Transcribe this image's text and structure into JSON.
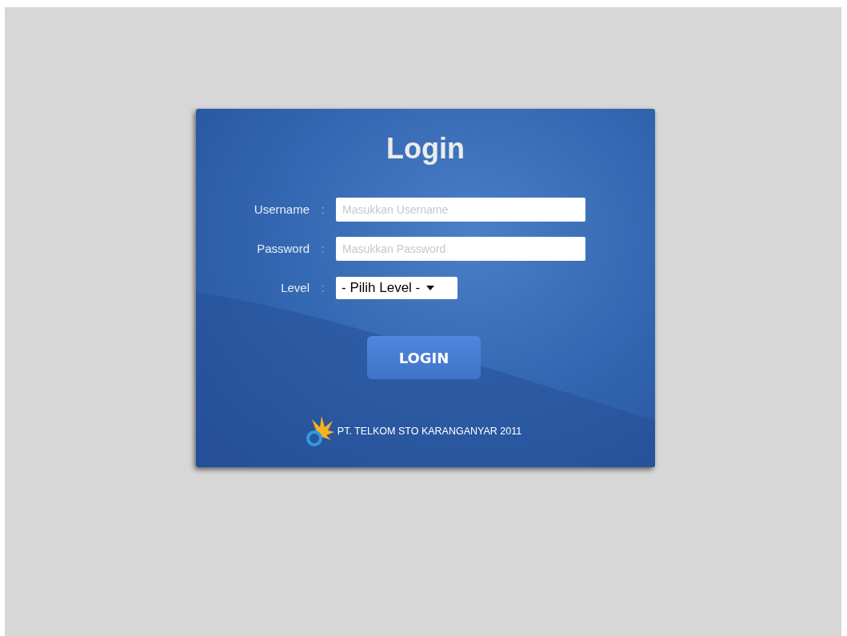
{
  "title": "Login",
  "fields": [
    {
      "label": "Username",
      "separator": ":",
      "placeholder": "Masukkan Username",
      "kind": "text"
    },
    {
      "label": "Password",
      "separator": ":",
      "placeholder": "Masukkan Password",
      "kind": "password"
    },
    {
      "label": "Level",
      "separator": ":",
      "value": "- Pilih Level -",
      "kind": "select"
    }
  ],
  "button": "LOGIN",
  "footer": "PT. TELKOM STO KARANGANYAR 2011"
}
